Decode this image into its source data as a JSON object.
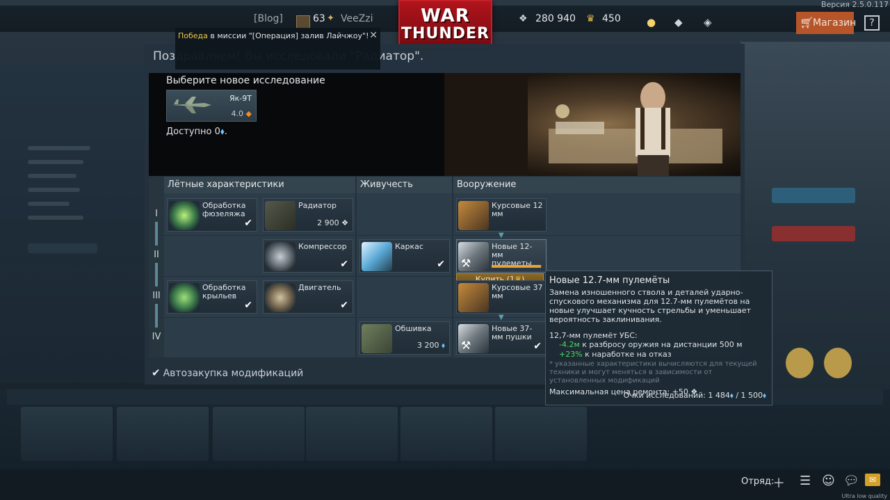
{
  "topbar": {
    "version": "Версия 2.5.0.117",
    "blog": "[Blog]",
    "level": "63",
    "username": "VeeZzi",
    "silver_lions": "280 940",
    "golden_eagles": "450",
    "shop": "Магазин",
    "help": "?",
    "logo_line1": "WAR",
    "logo_line2": "THUNDER"
  },
  "notification": {
    "highlight": "Победа",
    "text": " в миссии \"[Операция] залив Лайчжоу\"!"
  },
  "modal": {
    "title": "Поздравляем! Вы исследовали \"Радиатор\".",
    "choose_label": "Выберите новое исследование",
    "vehicle": {
      "name": "Як-9Т",
      "br": "4.0"
    },
    "available": "Доступно 0",
    "available_suffix": "."
  },
  "columns": {
    "flight": "Лётные характеристики",
    "survivability": "Живучесть",
    "armament": "Вооружение"
  },
  "tiers": [
    "I",
    "II",
    "III",
    "IV"
  ],
  "mods": {
    "fuselage": {
      "name": "Обработка фюзеляжа"
    },
    "radiator": {
      "name": "Радиатор",
      "price": "2 900"
    },
    "compressor": {
      "name": "Компрессор"
    },
    "frame": {
      "name": "Каркас"
    },
    "wings": {
      "name": "Обработка крыльев"
    },
    "engine": {
      "name": "Двигатель"
    },
    "cover": {
      "name": "Обшивка",
      "price": "3 200"
    },
    "mg12": {
      "name": "Курсовые 12 мм"
    },
    "newmg12": {
      "name": "Новые 12-мм пулеметы",
      "progress": 0.99
    },
    "mg37": {
      "name": "Курсовые 37 мм"
    },
    "newmg37": {
      "name": "Новые 37-мм пушки"
    }
  },
  "buy_button": "Купить (1",
  "buy_button_suffix": ")",
  "autobuy": "Автозакупка модификаций",
  "tooltip": {
    "title": "Новые 12.7-мм пулемёты",
    "description": "Замена изношенного ствола и деталей ударно-спускового механизма для 12.7-мм пулемётов на новые улучшает кучность стрельбы и уменьшает вероятность заклинивания.",
    "weapon": "12,7-мм пулемёт УБС:",
    "stat1_value": "-4.2м",
    "stat1_text": " к разбросу оружия на дистанции 500 м",
    "stat2_value": "+23%",
    "stat2_text": " к наработке на отказ",
    "note": "* указанные характеристики вычисляются для текущей техники и могут меняться в зависимости от установленных модификаций",
    "repair": "Максимальная цена ремонта: +50",
    "research": "Очки исследований: 1 484",
    "research_total": " / 1 500"
  },
  "bottombar": {
    "squad": "Отряд:",
    "quality": "Ultra low quality"
  },
  "colors": {
    "accent_orange": "#b6542a",
    "progress": "#e8a23a",
    "positive": "#4cd964",
    "highlight": "#f2c94c",
    "logo_red": "#b0141c"
  }
}
